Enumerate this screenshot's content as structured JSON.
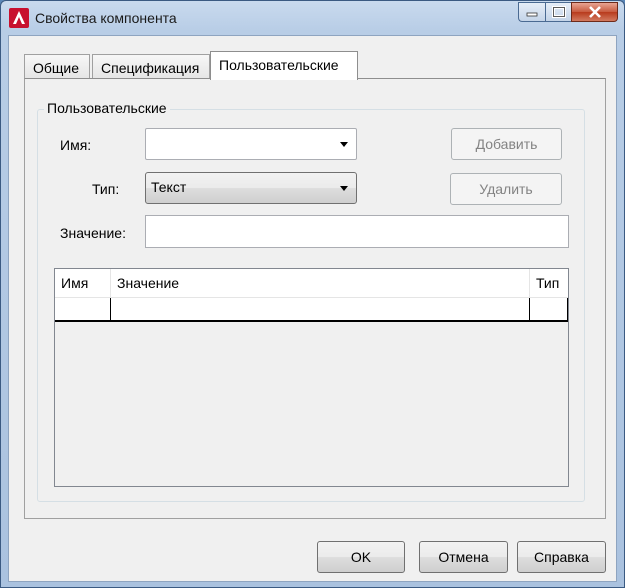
{
  "window": {
    "title": "Свойства компонента",
    "accent_color": "#b8cde6",
    "close_color": "#c75a3e"
  },
  "tabs": [
    {
      "label": "Общие",
      "active": false
    },
    {
      "label": "Спецификация",
      "active": false
    },
    {
      "label": "Пользовательские",
      "active": true
    }
  ],
  "group": {
    "title": "Пользовательские",
    "name_label": "Имя:",
    "name_value": "",
    "type_label": "Тип:",
    "type_value": "Текст",
    "value_label": "Значение:",
    "value_value": "",
    "add_button": "Добавить",
    "remove_button": "Удалить"
  },
  "table": {
    "columns": [
      "Имя",
      "Значение",
      "Тип"
    ],
    "rows": [
      [
        "",
        "",
        ""
      ]
    ]
  },
  "footer": {
    "ok": "OK",
    "cancel": "Отмена",
    "help": "Справка"
  }
}
